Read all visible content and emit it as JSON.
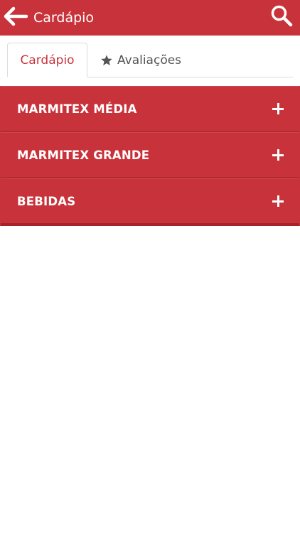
{
  "header": {
    "title": "Cardápio",
    "back_icon": "arrow-left-icon",
    "search_icon": "search-icon"
  },
  "tabs": [
    {
      "label": "Cardápio",
      "active": true
    },
    {
      "label": "Avaliações",
      "active": false,
      "icon": "star-icon"
    }
  ],
  "menu_sections": [
    {
      "label": "MARMITEX MÉDIA",
      "icon": "plus-icon"
    },
    {
      "label": "MARMITEX GRANDE",
      "icon": "plus-icon"
    },
    {
      "label": "BEBIDAS",
      "icon": "plus-icon"
    }
  ],
  "colors": {
    "brand": "#c8323a",
    "text_on_brand": "#ffffff",
    "inactive_tab_text": "#555555"
  }
}
